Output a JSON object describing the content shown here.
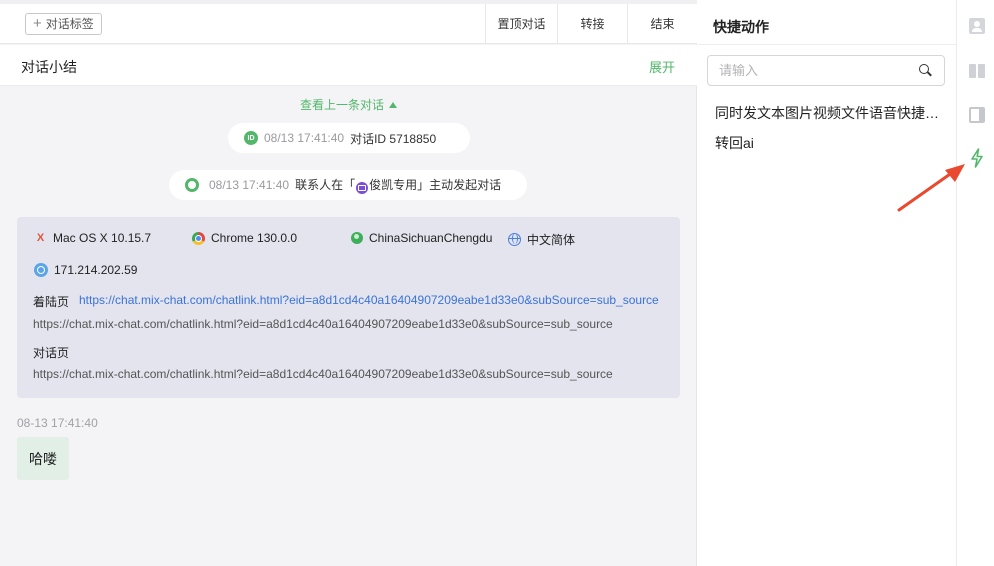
{
  "toolbar": {
    "add_tag_label": "对话标签",
    "pin_label": "置顶对话",
    "transfer_label": "转接",
    "end_label": "结束"
  },
  "summary": {
    "title": "对话小结",
    "expand_label": "展开"
  },
  "conversation": {
    "prev_link": "查看上一条对话",
    "system_1": {
      "time": "08/13 17:41:40",
      "text": "对话ID 5718850"
    },
    "system_2": {
      "time": "08/13 17:41:40",
      "prefix": "联系人在「",
      "channel": "俊凯专用",
      "suffix": "」主动发起对话"
    },
    "visitor_info": {
      "os": "Mac OS X 10.15.7",
      "browser": "Chrome 130.0.0",
      "location": "ChinaSichuanChengdu",
      "language": "中文简体",
      "ip": "171.214.202.59",
      "landing_label": "着陆页",
      "landing_url": "https://chat.mix-chat.com/chatlink.html?eid=a8d1cd4c40a16404907209eabe1d33e0&subSource=sub_source",
      "landing_url_2": "https://chat.mix-chat.com/chatlink.html?eid=a8d1cd4c40a16404907209eabe1d33e0&subSource=sub_source",
      "chat_label": "对话页",
      "chat_url": "https://chat.mix-chat.com/chatlink.html?eid=a8d1cd4c40a16404907209eabe1d33e0&subSource=sub_source"
    },
    "message": {
      "time": "08-13 17:41:40",
      "text": "哈喽"
    }
  },
  "quick_actions": {
    "title": "快捷动作",
    "search_placeholder": "请输入",
    "items": [
      "同时发文本图片视频文件语音快捷动作",
      "转回ai"
    ]
  },
  "colors": {
    "accent": "#52b76a",
    "link": "#3a73d8",
    "annotation_arrow": "#e8492f"
  }
}
